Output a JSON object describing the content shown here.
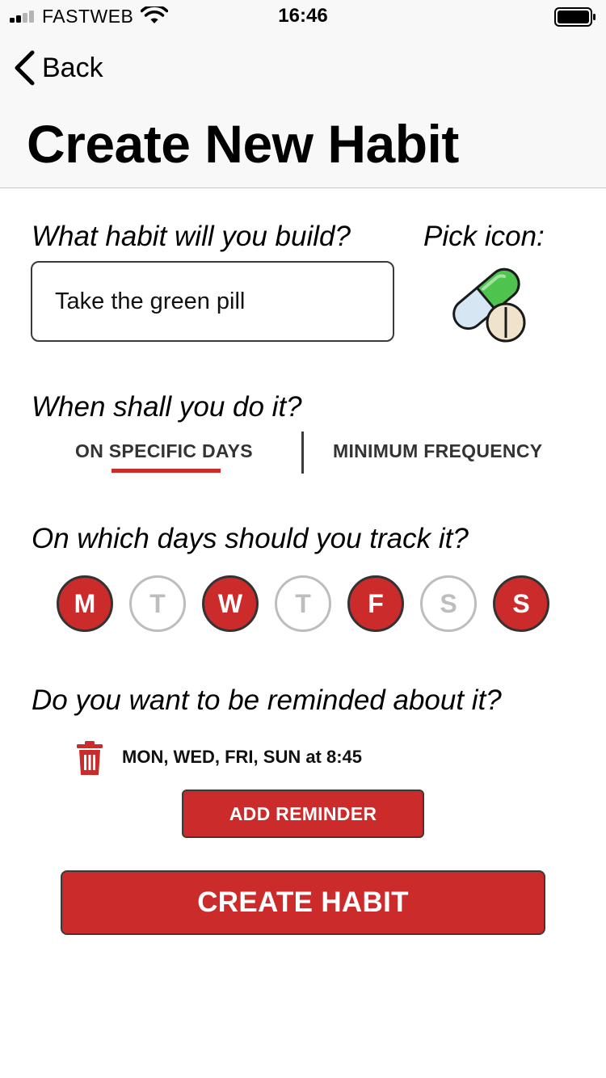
{
  "status_bar": {
    "carrier": "FASTWEB",
    "time": "16:46",
    "icons": [
      "signal-icon",
      "wifi-icon",
      "battery-icon"
    ]
  },
  "nav": {
    "back_label": "Back",
    "title": "Create New Habit"
  },
  "habit": {
    "question": "What habit will you build?",
    "value": "Take the green pill",
    "icon_label": "Pick icon:",
    "icon": "pill-icon"
  },
  "schedule": {
    "question": "When shall you do it?",
    "tabs": [
      {
        "label": "ON SPECIFIC DAYS",
        "active": true
      },
      {
        "label": "MINIMUM FREQUENCY",
        "active": false
      }
    ]
  },
  "days": {
    "question": "On which days should you track it?",
    "items": [
      {
        "letter": "M",
        "selected": true
      },
      {
        "letter": "T",
        "selected": false
      },
      {
        "letter": "W",
        "selected": true
      },
      {
        "letter": "T",
        "selected": false
      },
      {
        "letter": "F",
        "selected": true
      },
      {
        "letter": "S",
        "selected": false
      },
      {
        "letter": "S",
        "selected": true
      }
    ]
  },
  "reminders": {
    "question": "Do you want to be reminded about it?",
    "items": [
      {
        "text": "MON, WED, FRI, SUN at 8:45",
        "icon": "trash-icon"
      }
    ],
    "add_label": "ADD REMINDER"
  },
  "create_label": "CREATE HABIT",
  "colors": {
    "accent": "#cc2b2b",
    "header_bg": "#f8f8f8",
    "border": "#3a3a3a",
    "inactive": "#bdbdbd"
  }
}
